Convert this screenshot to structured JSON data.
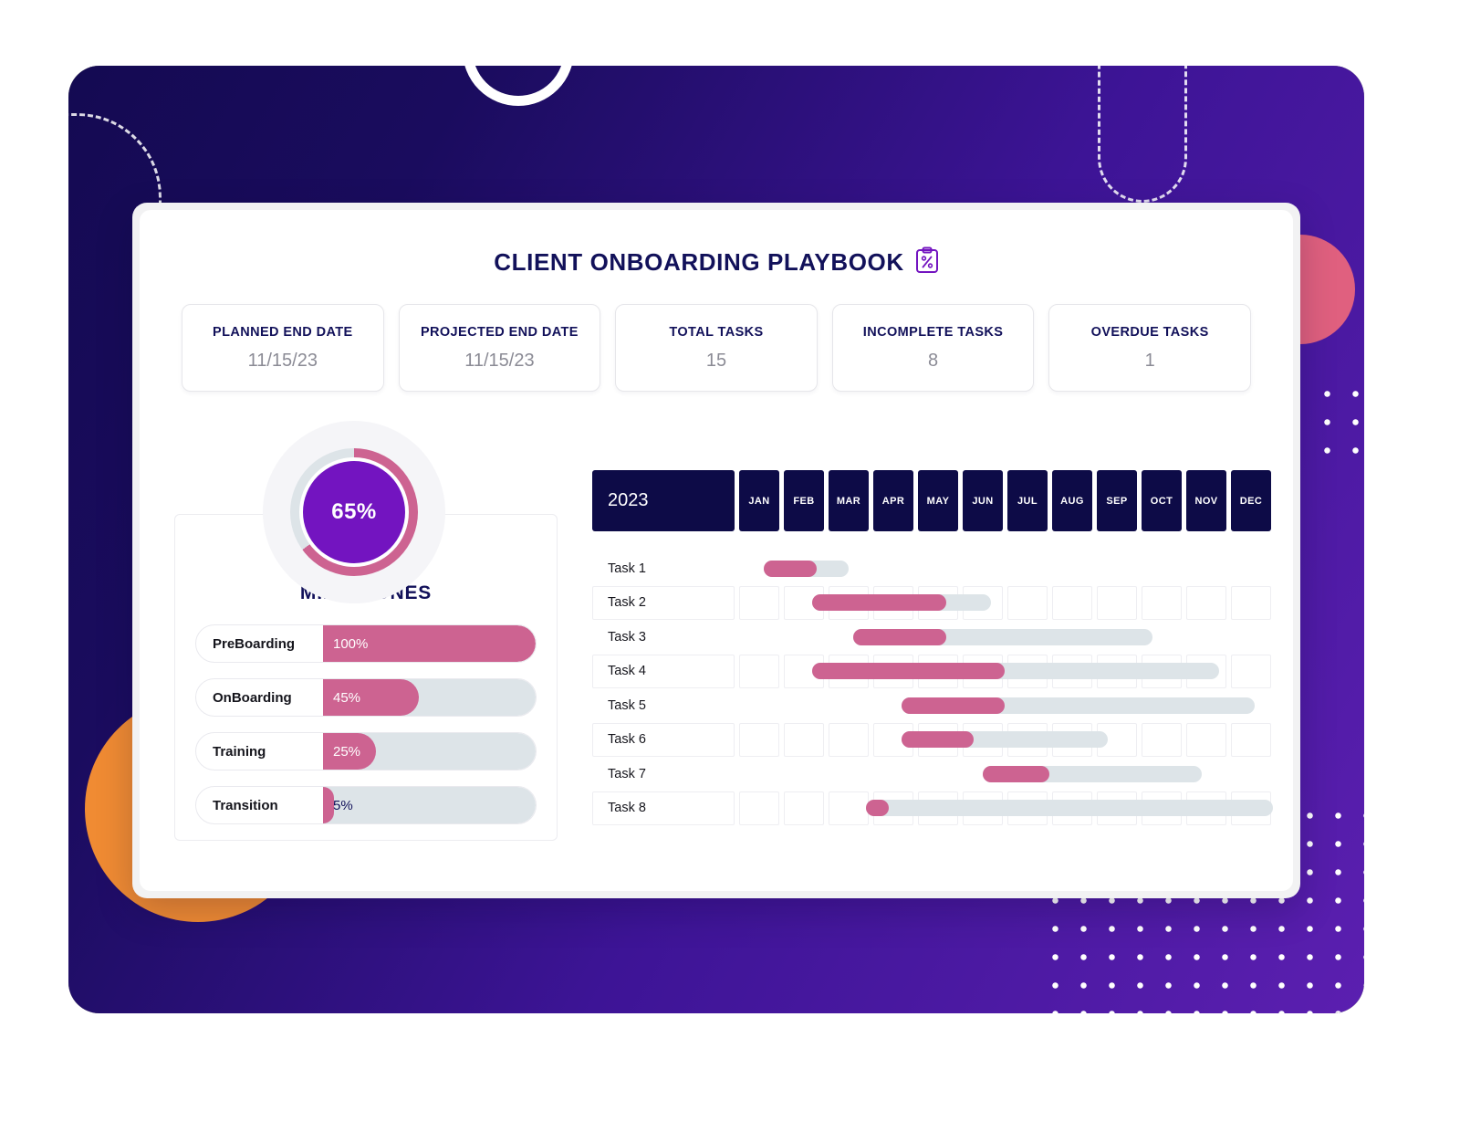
{
  "header": {
    "title": "CLIENT ONBOARDING PLAYBOOK",
    "icon": "clipboard-percent-icon"
  },
  "kpis": [
    {
      "label": "PLANNED END DATE",
      "value": "11/15/23"
    },
    {
      "label": "PROJECTED END DATE",
      "value": "11/15/23"
    },
    {
      "label": "TOTAL TASKS",
      "value": "15"
    },
    {
      "label": "INCOMPLETE TASKS",
      "value": "8"
    },
    {
      "label": "OVERDUE TASKS",
      "value": "1"
    }
  ],
  "donut": {
    "percent_label": "65%",
    "percent_value": 65,
    "fill_color": "#cd6391",
    "track_color": "#dde4e8",
    "center_color": "#7314c0"
  },
  "milestones": {
    "heading": "MILESTONES",
    "items": [
      {
        "name": "PreBoarding",
        "percent_label": "100%",
        "percent": 100
      },
      {
        "name": "OnBoarding",
        "percent_label": "45%",
        "percent": 45
      },
      {
        "name": "Training",
        "percent_label": "25%",
        "percent": 25
      },
      {
        "name": "Transition",
        "percent_label": "5%",
        "percent": 5
      }
    ]
  },
  "gantt": {
    "year": "2023",
    "months": [
      "JAN",
      "FEB",
      "MAR",
      "APR",
      "MAY",
      "JUN",
      "JUL",
      "AUG",
      "SEP",
      "OCT",
      "NOV",
      "DEC"
    ],
    "rows": [
      {
        "task": "Task 1",
        "plan_start": 0.5,
        "plan_end": 2.4,
        "actual_start": 0.5,
        "actual_end": 1.7
      },
      {
        "task": "Task 2",
        "plan_start": 1.6,
        "plan_end": 5.6,
        "actual_start": 1.6,
        "actual_end": 4.6
      },
      {
        "task": "Task 3",
        "plan_start": 2.5,
        "plan_end": 9.2,
        "actual_start": 2.5,
        "actual_end": 4.6
      },
      {
        "task": "Task 4",
        "plan_start": 1.6,
        "plan_end": 10.7,
        "actual_start": 1.6,
        "actual_end": 5.9
      },
      {
        "task": "Task 5",
        "plan_start": 3.6,
        "plan_end": 11.5,
        "actual_start": 3.6,
        "actual_end": 5.9
      },
      {
        "task": "Task 6",
        "plan_start": 3.6,
        "plan_end": 8.2,
        "actual_start": 3.6,
        "actual_end": 5.2
      },
      {
        "task": "Task 7",
        "plan_start": 5.4,
        "plan_end": 10.3,
        "actual_start": 5.4,
        "actual_end": 6.9
      },
      {
        "task": "Task 8",
        "plan_start": 2.8,
        "plan_end": 11.9,
        "actual_start": 2.8,
        "actual_end": 3.3
      }
    ]
  },
  "colors": {
    "brand_navy": "#12115a",
    "header_navy": "#0d0b47",
    "accent_pink": "#cd6391",
    "accent_purple": "#7314c0",
    "track_gray": "#dde4e8",
    "tablet_bg_start": "#140a52",
    "tablet_bg_end": "#5b1fb0",
    "orange_circle": "#f08b33"
  }
}
